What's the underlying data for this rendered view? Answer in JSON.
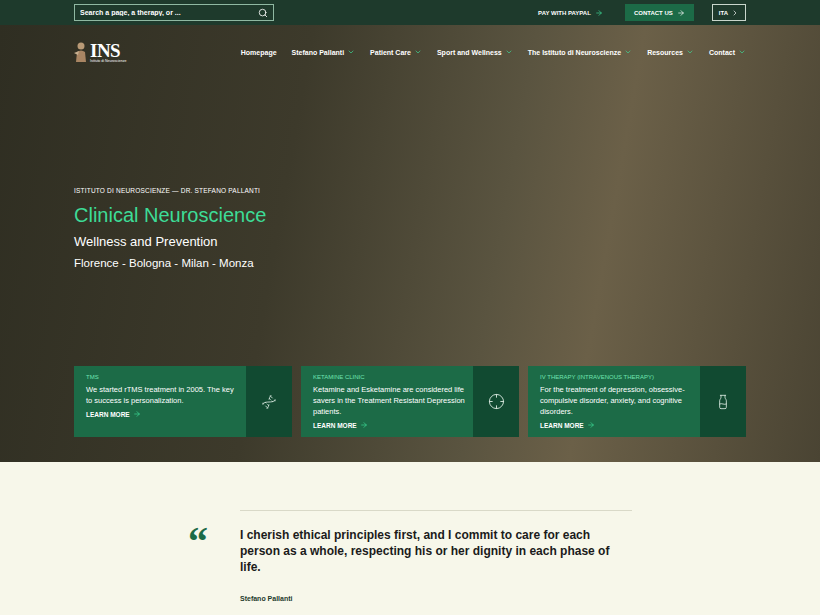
{
  "search": {
    "placeholder": "Search a page, a therapy, or ..."
  },
  "topbar": {
    "paypal": "PAY WITH PAYPAL",
    "contact": "CONTACT US",
    "language": "ITA"
  },
  "logo": {
    "text": "INS",
    "subtitle": "Istituto di Neuroscienze"
  },
  "nav": [
    {
      "label": "Homepage",
      "dropdown": false
    },
    {
      "label": "Stefano Pallanti",
      "dropdown": true
    },
    {
      "label": "Patient Care",
      "dropdown": true
    },
    {
      "label": "Sport and Wellness",
      "dropdown": true
    },
    {
      "label": "The Istituto di Neuroscienze",
      "dropdown": true
    },
    {
      "label": "Resources",
      "dropdown": true
    },
    {
      "label": "Contact",
      "dropdown": true
    }
  ],
  "hero": {
    "eyebrow": "ISTITUTO DI NEUROSCIENZE — DR. STEFANO PALLANTI",
    "title": "Clinical Neuroscience",
    "subtitle": "Wellness and Prevention",
    "locations": "Florence - Bologna - Milan - Monza"
  },
  "cards": [
    {
      "kind": "dna",
      "title": "TMS",
      "body": "We started rTMS treatment in 2005. The key to success is personalization.",
      "link": "LEARN MORE"
    },
    {
      "kind": "target",
      "title": "KETAMINE CLINIC",
      "body": "Ketamine and Esketamine are considered life savers in the Treatment Resistant Depression patients.",
      "link": "LEARN MORE"
    },
    {
      "kind": "bottle",
      "title": "IV THERAPY (INTRAVENOUS THERAPY)",
      "body": "For the treatment of depression, obsessive-compulsive disorder, anxiety, and cognitive disorders.",
      "link": "LEARN MORE"
    }
  ],
  "quote": {
    "mark": "“",
    "text": "I cherish ethical principles first, and I commit to care for each person as a whole, respecting his or her dignity in each phase of life.",
    "author": "Stefano Pallanti"
  }
}
